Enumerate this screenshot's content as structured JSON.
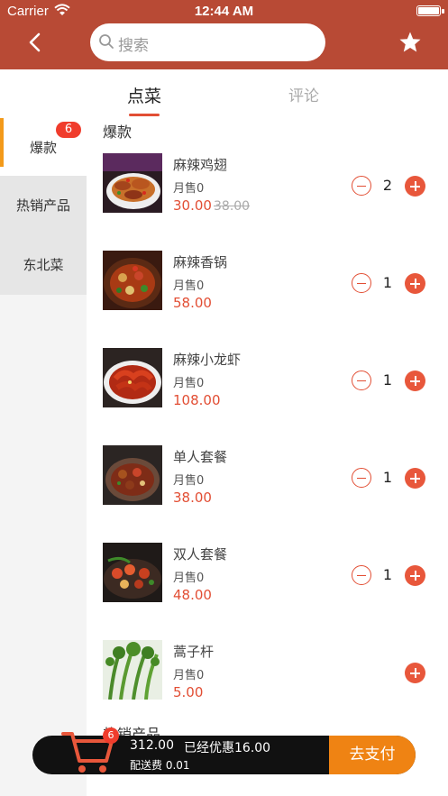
{
  "status_bar": {
    "carrier": "Carrier",
    "time": "12:44 AM"
  },
  "header": {
    "search_placeholder": "搜索",
    "back_icon": "chevron-left-icon",
    "favorite_icon": "star-icon"
  },
  "tabs": [
    {
      "label": "点菜",
      "active": true
    },
    {
      "label": "评论",
      "active": false
    }
  ],
  "sidebar": {
    "items": [
      {
        "label": "爆款",
        "badge": "6",
        "active": true
      },
      {
        "label": "热销产品",
        "active": false
      },
      {
        "label": "东北菜",
        "active": false
      }
    ]
  },
  "menu": {
    "section_title": "爆款",
    "next_section_title": "热销产品",
    "items": [
      {
        "name": "麻辣鸡翅",
        "sales": "月售0",
        "price": "30.00",
        "original_price": "38.00",
        "qty": "2"
      },
      {
        "name": "麻辣香锅",
        "sales": "月售0",
        "price": "58.00",
        "qty": "1"
      },
      {
        "name": "麻辣小龙虾",
        "sales": "月售0",
        "price": "108.00",
        "qty": "1"
      },
      {
        "name": "单人套餐",
        "sales": "月售0",
        "price": "38.00",
        "qty": "1"
      },
      {
        "name": "双人套餐",
        "sales": "月售0",
        "price": "48.00",
        "qty": "1"
      },
      {
        "name": "蒿子杆",
        "sales": "月售0",
        "price": "5.00"
      }
    ]
  },
  "cart": {
    "count": "6",
    "total": "312.00",
    "discount": "已经优惠16.00",
    "delivery": "配送费 0.01",
    "pay_label": "去支付"
  },
  "colors": {
    "header": "#b84a35",
    "accent": "#e24e34",
    "pay": "#ef8313",
    "sidebar_marker": "#f39a1a"
  }
}
